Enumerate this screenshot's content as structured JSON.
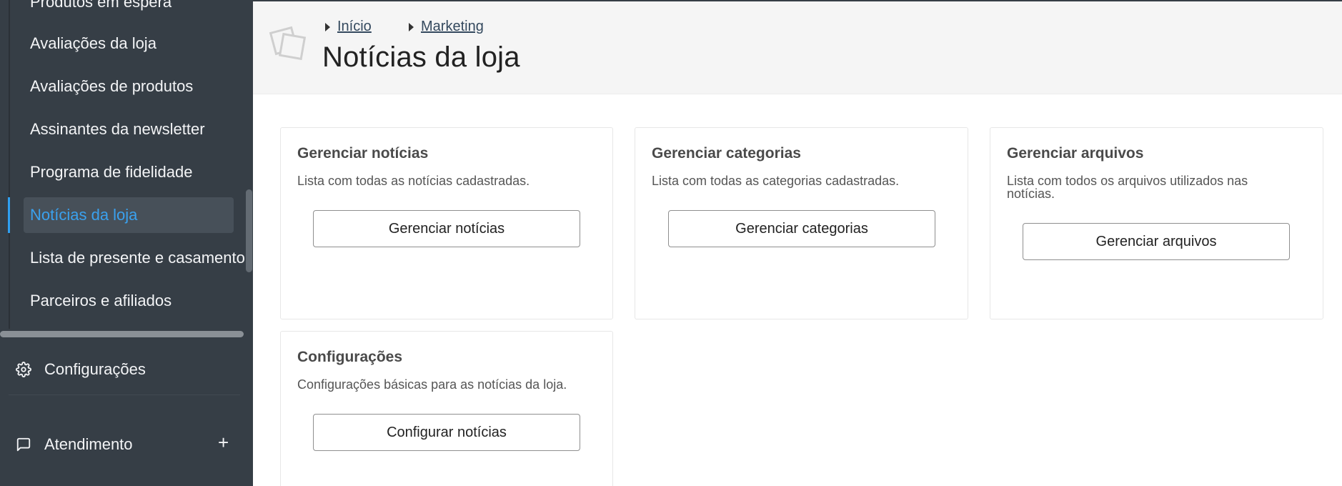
{
  "sidebar": {
    "items": [
      {
        "label": "Produtos em espera"
      },
      {
        "label": "Avaliações da loja"
      },
      {
        "label": "Avaliações de produtos"
      },
      {
        "label": "Assinantes da newsletter"
      },
      {
        "label": "Programa de fidelidade"
      },
      {
        "label": "Notícias da loja",
        "active": true
      },
      {
        "label": "Lista de presente e casamento"
      },
      {
        "label": "Parceiros e afiliados"
      }
    ],
    "sections": [
      {
        "label": "Configurações",
        "icon": "gear-icon"
      },
      {
        "label": "Atendimento",
        "icon": "chat-icon"
      }
    ],
    "accent_color": "#3aa1ee"
  },
  "breadcrumb": {
    "items": [
      {
        "label": "Início"
      },
      {
        "label": "Marketing"
      }
    ]
  },
  "page": {
    "title": "Notícias da loja"
  },
  "cards": [
    {
      "title": "Gerenciar notícias",
      "description": "Lista com todas as notícias cadastradas.",
      "button": "Gerenciar notícias"
    },
    {
      "title": "Gerenciar categorias",
      "description": "Lista com todas as categorias cadastradas.",
      "button": "Gerenciar categorias"
    },
    {
      "title": "Gerenciar arquivos",
      "description": "Lista com todos os arquivos utilizados nas notícias.",
      "button": "Gerenciar arquivos"
    },
    {
      "title": "Configurações",
      "description": "Configurações básicas para as notícias da loja.",
      "button": "Configurar notícias"
    }
  ]
}
